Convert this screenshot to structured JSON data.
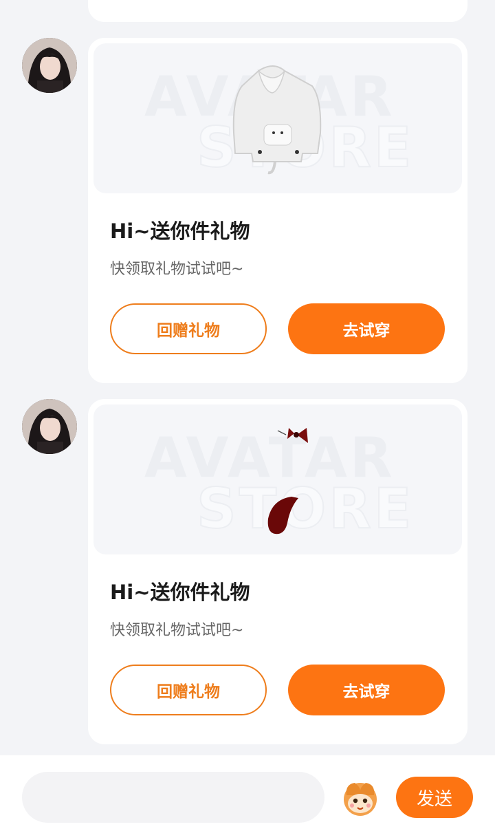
{
  "messages": [
    {
      "preview": {
        "watermark_line1": "AVATAR",
        "watermark_line2": "STORE",
        "item_icon": "hoodie-icon"
      },
      "title": "Hi~送你件礼物",
      "subtitle": "快领取礼物试试吧~",
      "return_gift_label": "回赠礼物",
      "try_on_label": "去试穿"
    },
    {
      "preview": {
        "watermark_line1": "AVATAR",
        "watermark_line2": "STORE",
        "item_icon": "bow-and-tail-icon"
      },
      "title": "Hi~送你件礼物",
      "subtitle": "快领取礼物试试吧~",
      "return_gift_label": "回赠礼物",
      "try_on_label": "去试穿"
    }
  ],
  "composer": {
    "placeholder": "",
    "send_label": "发送",
    "emoji_icon": "monkey-emoji-icon"
  },
  "colors": {
    "accent": "#fd7412",
    "outline": "#ee7d1c",
    "background": "#f3f4f7"
  }
}
